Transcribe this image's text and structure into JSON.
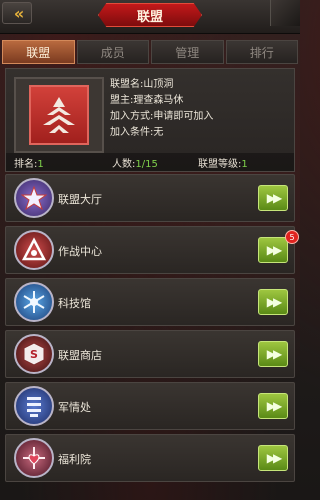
{
  "header": {
    "back_glyph": "«",
    "title": "联盟"
  },
  "tabs": [
    {
      "label": "联盟",
      "active": true
    },
    {
      "label": "成员",
      "active": false
    },
    {
      "label": "管理",
      "active": false
    },
    {
      "label": "排行",
      "active": false
    }
  ],
  "alliance": {
    "name_line": "联盟名:山顶洞",
    "leader_line": "盟主:理查森马休",
    "join_method_line": "加入方式:申请即可加入",
    "join_condition_line": "加入条件:无",
    "rank_label": "排名:",
    "rank_value": "1",
    "members_label": "人数:",
    "members_value": "1/15",
    "level_label": "联盟等级:",
    "level_value": "1"
  },
  "menu": [
    {
      "label": "联盟大厅",
      "icon": "alliance-hall-icon",
      "icon_color": "#6b4fa6"
    },
    {
      "label": "作战中心",
      "icon": "combat-center-icon",
      "icon_color": "#a02a2a",
      "badge": "5"
    },
    {
      "label": "科技馆",
      "icon": "tech-hall-icon",
      "icon_color": "#2f6fb8"
    },
    {
      "label": "联盟商店",
      "icon": "alliance-shop-icon",
      "icon_color": "#7a2b2b"
    },
    {
      "label": "军情处",
      "icon": "intel-office-icon",
      "icon_color": "#3a5aa6"
    },
    {
      "label": "福利院",
      "icon": "welfare-hall-icon",
      "icon_color": "#9a3f56"
    }
  ],
  "go_button_glyph": "▶▶"
}
